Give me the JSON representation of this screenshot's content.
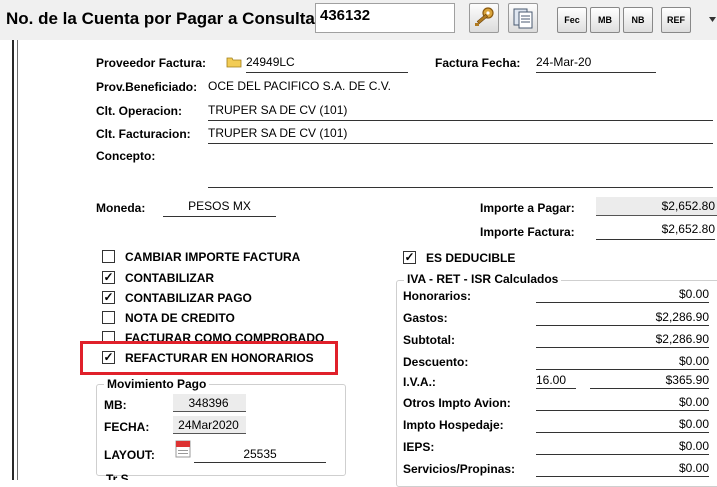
{
  "header": {
    "label": "No. de la Cuenta por Pagar a Consultar:",
    "account_number": "436132",
    "buttons": [
      "Fec",
      "MB",
      "NB",
      "REF"
    ]
  },
  "invoice": {
    "proveedor_label": "Proveedor Factura:",
    "proveedor_value": "24949LC",
    "factura_fecha_label": "Factura Fecha:",
    "factura_fecha_value": "24-Mar-20",
    "prov_benef_label": "Prov.Beneficiado:",
    "prov_benef_value": "OCE DEL PACIFICO S.A. DE C.V.",
    "clt_operacion_label": "Clt. Operacion:",
    "clt_operacion_value": "TRUPER SA DE CV (101)",
    "clt_facturacion_label": "Clt. Facturacion:",
    "clt_facturacion_value": "TRUPER SA DE CV (101)",
    "concepto_label": "Concepto:",
    "moneda_label": "Moneda:",
    "moneda_value": "PESOS MX",
    "importe_pagar_label": "Importe a Pagar:",
    "importe_pagar_value": "$2,652.80",
    "importe_factura_label": "Importe Factura:",
    "importe_factura_value": "$2,652.80"
  },
  "options": [
    {
      "label": "CAMBIAR IMPORTE FACTURA",
      "checked": false
    },
    {
      "label": "CONTABILIZAR",
      "checked": true
    },
    {
      "label": "CONTABILIZAR PAGO",
      "checked": true
    },
    {
      "label": "NOTA DE CREDITO",
      "checked": false
    },
    {
      "label": "FACTURAR COMO COMPROBADO",
      "checked": false
    },
    {
      "label": "REFACTURAR EN HONORARIOS",
      "checked": true
    }
  ],
  "movimiento": {
    "title": "Movimiento Pago",
    "mb_label": "MB:",
    "mb_value": "348396",
    "fecha_label": "FECHA:",
    "fecha_value": "24Mar2020",
    "layout_label": "LAYOUT:",
    "layout_value": "25535",
    "partial_text": "Tr S"
  },
  "deducible": {
    "label": "ES DEDUCIBLE",
    "checked": true
  },
  "calc": {
    "title": "IVA - RET - ISR Calculados",
    "rows": [
      {
        "label": "Honorarios:",
        "value": "$0.00"
      },
      {
        "label": "Gastos:",
        "value": "$2,286.90"
      },
      {
        "label": "Subtotal:",
        "value": "$2,286.90"
      },
      {
        "label": "Descuento:",
        "value": "$0.00"
      },
      {
        "label": "I.V.A.:",
        "value": "$365.90",
        "rate": "16.00"
      },
      {
        "label": "Otros Impto Avion:",
        "value": "$0.00"
      },
      {
        "label": "Impto Hospedaje:",
        "value": "$0.00"
      },
      {
        "label": "IEPS:",
        "value": "$0.00"
      },
      {
        "label": "Servicios/Propinas:",
        "value": "$0.00"
      }
    ]
  },
  "colors": {
    "highlight": "#e0202a",
    "toolbar_bg": "#f0f0f0",
    "readonly_bg": "#ececec"
  }
}
